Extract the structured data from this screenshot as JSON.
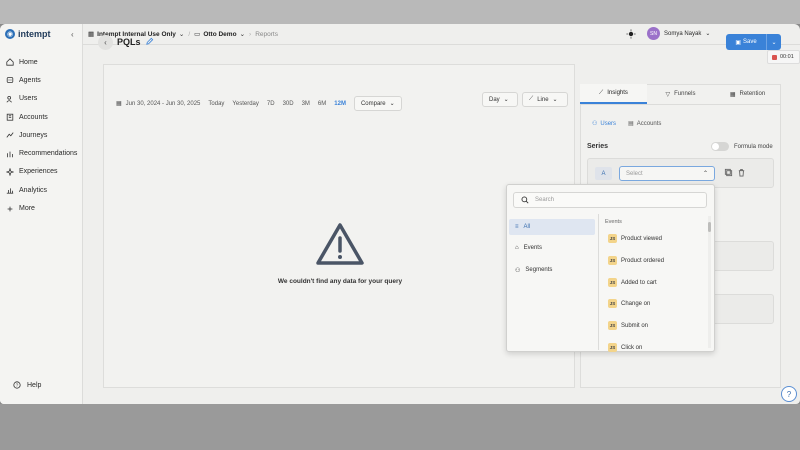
{
  "app": {
    "logo_text": "intempt"
  },
  "breadcrumb": {
    "workspace": "Intempt Internal Use Only",
    "project": "Otto Demo",
    "section": "Reports"
  },
  "user": {
    "initials": "SN",
    "name": "Somya Nayak"
  },
  "sidebar": {
    "items": [
      {
        "label": "Home",
        "icon": "home-icon"
      },
      {
        "label": "Agents",
        "icon": "agents-icon"
      },
      {
        "label": "Users",
        "icon": "users-icon"
      },
      {
        "label": "Accounts",
        "icon": "accounts-icon"
      },
      {
        "label": "Journeys",
        "icon": "journeys-icon"
      },
      {
        "label": "Recommendations",
        "icon": "recommendations-icon"
      },
      {
        "label": "Experiences",
        "icon": "experiences-icon"
      },
      {
        "label": "Analytics",
        "icon": "analytics-icon"
      },
      {
        "label": "More",
        "icon": "plus-icon"
      }
    ],
    "help_label": "Help"
  },
  "page": {
    "title": "PQLs",
    "save_label": "Save",
    "timer": "00:01"
  },
  "toolbar": {
    "date_range": "Jun 30, 2024 - Jun 30, 2025",
    "ranges": [
      "Today",
      "Yesterday",
      "7D",
      "30D",
      "3M",
      "6M",
      "12M"
    ],
    "active_range": "12M",
    "compare_label": "Compare",
    "interval_label": "Day",
    "chart_type_label": "Line"
  },
  "empty_state": {
    "message": "We couldn't find any data for your query"
  },
  "right_panel": {
    "tabs": [
      "Insights",
      "Funnels",
      "Retention"
    ],
    "active_tab": "Insights",
    "segments": [
      "Users",
      "Accounts"
    ],
    "series_label": "Series",
    "formula_label": "Formula mode",
    "series_letter": "A",
    "select_placeholder": "Select"
  },
  "dropdown": {
    "search_placeholder": "Search",
    "categories": [
      "All",
      "Events",
      "Segments"
    ],
    "section_header": "Events",
    "items": [
      "Product viewed",
      "Product ordered",
      "Added to cart",
      "Change on",
      "Submit on",
      "Click on"
    ],
    "badge": "JS"
  },
  "colors": {
    "accent": "#3a82d8",
    "badge": "#f3d48a",
    "recording": "#d9534f"
  }
}
